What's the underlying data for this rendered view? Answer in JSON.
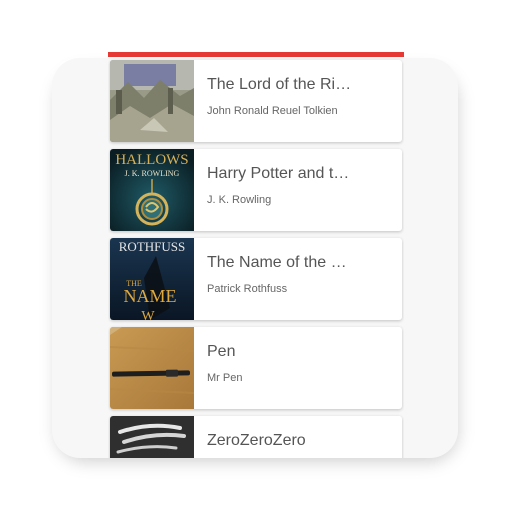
{
  "accent_color": "#e53935",
  "books": [
    {
      "title": "The Lord of the Ri…",
      "author": "John Ronald Reuel Tolkien",
      "cover_icon": "mountain-landscape-cover"
    },
    {
      "title": "Harry Potter and t…",
      "author": "J. K. Rowling",
      "cover_icon": "deathly-hallows-cover",
      "cover_text": [
        "HALLOWS",
        "J. K. ROWLING"
      ]
    },
    {
      "title": "The Name of the …",
      "author": "Patrick Rothfuss",
      "cover_icon": "name-of-the-wind-cover",
      "cover_text": [
        "ROTHFUSS",
        "THE",
        "NAME",
        "W"
      ]
    },
    {
      "title": "Pen",
      "author": "Mr Pen",
      "cover_icon": "pen-photo-cover"
    },
    {
      "title": "ZeroZeroZero",
      "author": "",
      "cover_icon": "zerozerozero-cover"
    }
  ]
}
